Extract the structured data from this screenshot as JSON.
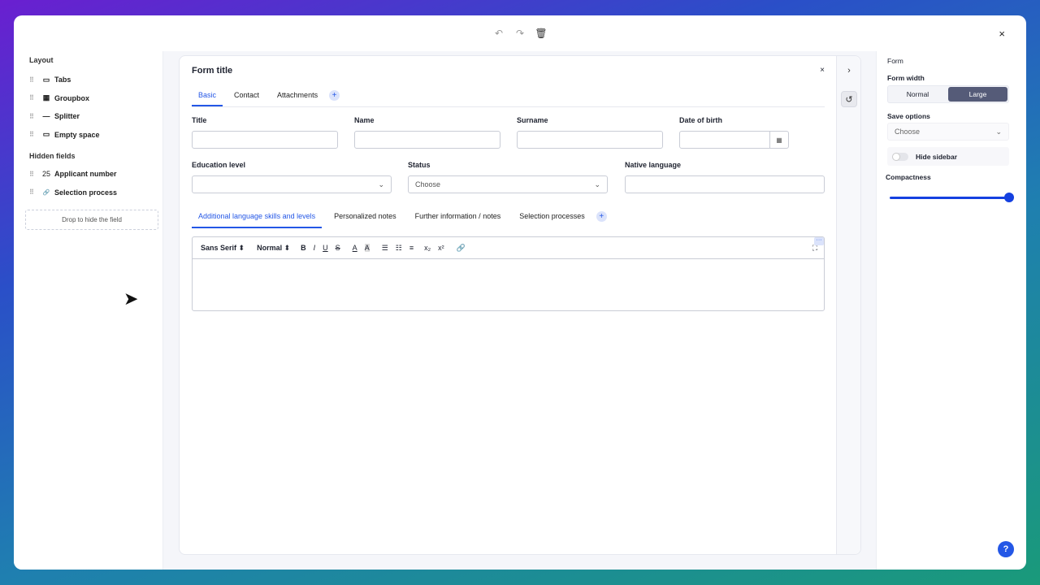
{
  "toolbar": {
    "undo_icon": "undo-icon",
    "redo_icon": "redo-icon",
    "delete_icon": "trash-icon",
    "close": "×"
  },
  "left": {
    "layout_title": "Layout",
    "layout_items": [
      {
        "label": "Tabs",
        "icon": "▭"
      },
      {
        "label": "Groupbox",
        "icon": "▦"
      },
      {
        "label": "Splitter",
        "icon": "—"
      },
      {
        "label": "Empty space",
        "icon": "▭"
      }
    ],
    "hidden_title": "Hidden fields",
    "hidden_items": [
      {
        "label": "Applicant number",
        "icon": "25"
      },
      {
        "label": "Selection process",
        "icon": "🔗"
      }
    ],
    "drop": "Drop to hide the field"
  },
  "form": {
    "title": "Form title",
    "close": "×",
    "tabs": [
      "Basic",
      "Contact",
      "Attachments"
    ],
    "add": "+",
    "fields": {
      "title": "Title",
      "name": "Name",
      "surname": "Surname",
      "dob": "Date of birth",
      "education": "Education level",
      "status": "Status",
      "status_value": "Choose",
      "native": "Native language"
    },
    "subtabs": [
      "Additional language skills and levels",
      "Personalized notes",
      "Further information / notes",
      "Selection processes"
    ],
    "editor": {
      "font": "Sans Serif",
      "size": "Normal",
      "more": "···"
    }
  },
  "right": {
    "section": "Form",
    "width_label": "Form width",
    "width_options": [
      "Normal",
      "Large"
    ],
    "width_selected": "Large",
    "save_label": "Save options",
    "save_value": "Choose",
    "hide_sidebar": "Hide sidebar",
    "hide_sidebar_on": false,
    "compactness": "Compactness",
    "compactness_value": 1.0,
    "help": "?"
  }
}
